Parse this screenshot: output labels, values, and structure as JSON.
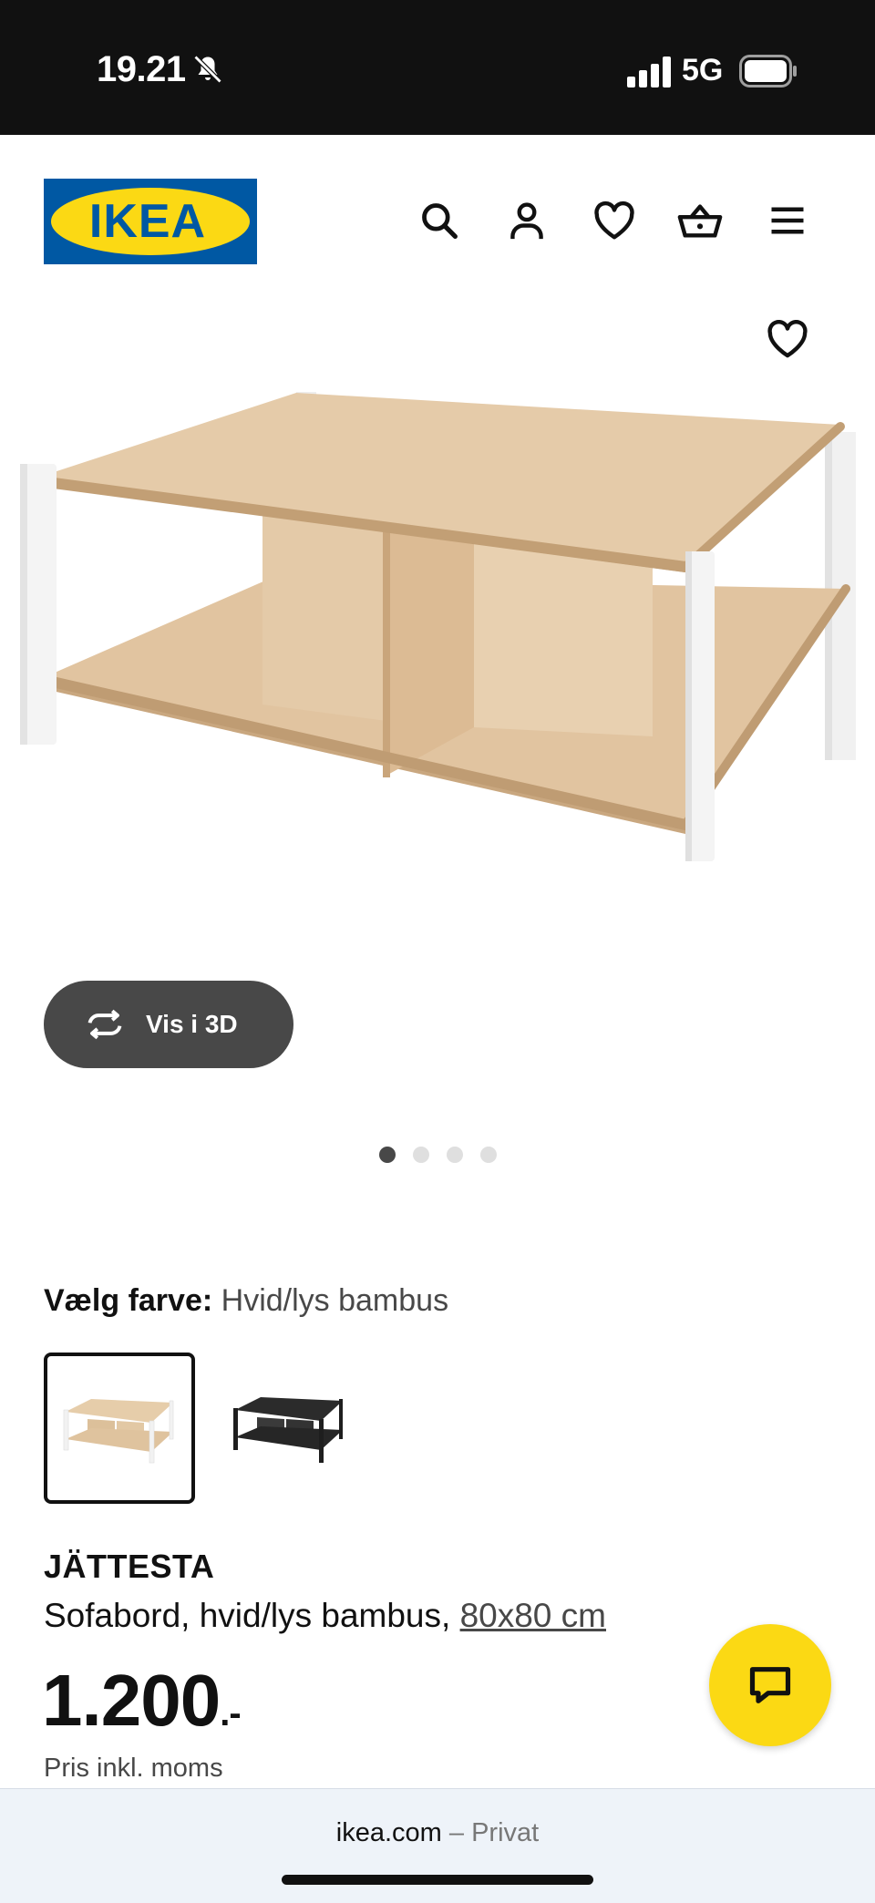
{
  "status_bar": {
    "time": "19.21",
    "network": "5G"
  },
  "header": {
    "logo_text": "IKEA",
    "icons": [
      "search-icon",
      "account-icon",
      "favourites-icon",
      "basket-icon",
      "menu-icon"
    ]
  },
  "gallery": {
    "button_3d_label": "Vis i 3D",
    "image_count": 4,
    "active_index": 0
  },
  "product": {
    "color_label": "Vælg farve:",
    "color_value": "Hvid/lys bambus",
    "swatches": [
      {
        "name": "Hvid/lys bambus",
        "selected": true
      },
      {
        "name": "Sort",
        "selected": false
      }
    ],
    "name": "JÄTTESTA",
    "description": "Sofabord, hvid/lys bambus,",
    "size_link": "80x80 cm",
    "price": "1.200",
    "price_suffix": ".-",
    "vat_note": "Pris inkl. moms"
  },
  "browser": {
    "domain": "ikea.com",
    "separator": "–",
    "mode": "Privat"
  },
  "colors": {
    "ikea_blue": "#0058a3",
    "ikea_yellow": "#fbd914",
    "dark_grey": "#484848"
  }
}
